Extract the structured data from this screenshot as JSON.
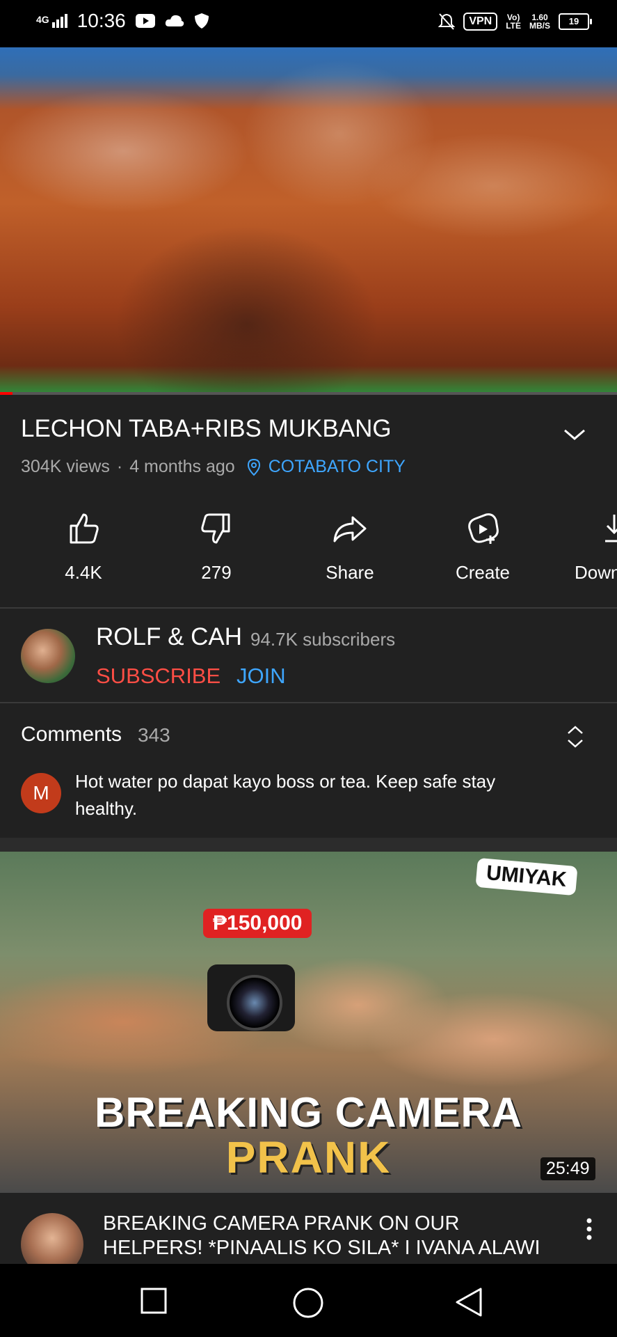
{
  "status_bar": {
    "network": "4G",
    "time": "10:36",
    "vpn": "VPN",
    "volte_top": "Vo)",
    "volte_bottom": "LTE",
    "speed_top": "1.60",
    "speed_bottom": "MB/S",
    "battery": "19",
    "icons": [
      "signal-icon",
      "youtube-icon",
      "cloud-icon",
      "shield-icon",
      "bell-off-icon",
      "battery-icon"
    ]
  },
  "video": {
    "title": "LECHON TABA+RIBS MUKBANG",
    "views": "304K views",
    "separator": "·",
    "age": "4 months ago",
    "location": "COTABATO CITY",
    "progress_fraction": 0.02
  },
  "actions": [
    {
      "label": "4.4K",
      "icon": "thumbs-up-icon"
    },
    {
      "label": "279",
      "icon": "thumbs-down-icon"
    },
    {
      "label": "Share",
      "icon": "share-icon"
    },
    {
      "label": "Create",
      "icon": "create-icon"
    },
    {
      "label": "Down",
      "icon": "download-icon"
    }
  ],
  "channel": {
    "name": "ROLF & CAH",
    "subscribers": "94.7K subscribers",
    "subscribe_label": "SUBSCRIBE",
    "join_label": "JOIN"
  },
  "comments": {
    "title": "Comments",
    "count": "343",
    "top_comment": {
      "avatar_letter": "M",
      "text": "Hot water po dapat kayo boss or tea. Keep safe stay healthy."
    }
  },
  "recommended": {
    "thumb_price": "₱150,000",
    "thumb_tag": "UMIYAK",
    "thumb_headline_1": "BREAKING CAMERA",
    "thumb_headline_2": "PRANK",
    "duration": "25:49",
    "title": "BREAKING CAMERA PRANK ON OUR HELPERS! *PINAALIS KO SILA* I IVANA ALAWI"
  },
  "colors": {
    "background": "#212121",
    "subscribe": "#ff4e45",
    "link": "#3ea6ff",
    "progress": "#ff0000"
  }
}
